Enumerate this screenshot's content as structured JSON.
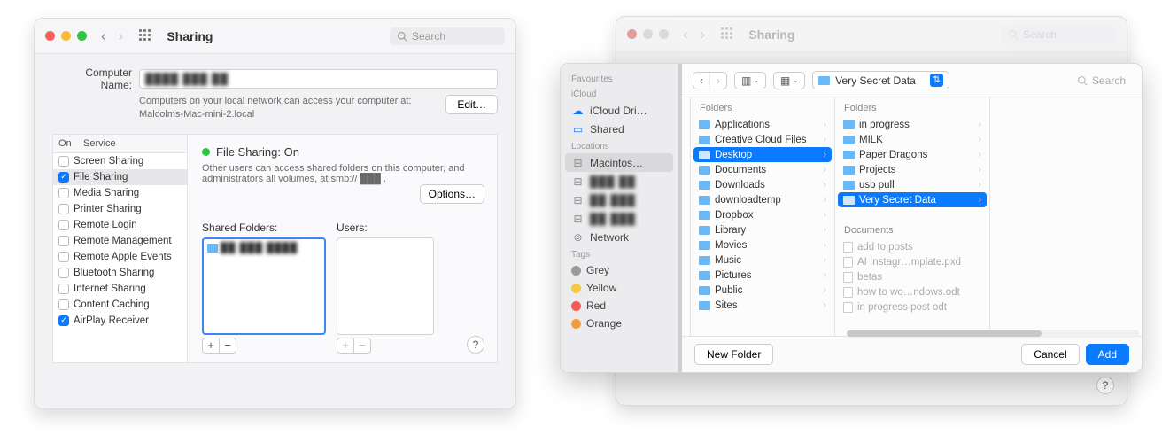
{
  "colors": {
    "accent": "#0a7bff",
    "green": "#2bc840"
  },
  "winA": {
    "title": "Sharing",
    "search_placeholder": "Search",
    "computer_name_label": "Computer Name:",
    "computer_name_value": "████  ███ ██",
    "hint_line1": "Computers on your local network can access your computer at:",
    "hint_line2": "Malcolms-Mac-mini-2.local",
    "edit_label": "Edit…",
    "svc_head_on": "On",
    "svc_head_service": "Service",
    "services": [
      {
        "on": false,
        "name": "Screen Sharing"
      },
      {
        "on": true,
        "name": "File Sharing",
        "selected": true
      },
      {
        "on": false,
        "name": "Media Sharing"
      },
      {
        "on": false,
        "name": "Printer Sharing"
      },
      {
        "on": false,
        "name": "Remote Login"
      },
      {
        "on": false,
        "name": "Remote Management"
      },
      {
        "on": false,
        "name": "Remote Apple Events"
      },
      {
        "on": false,
        "name": "Bluetooth Sharing"
      },
      {
        "on": false,
        "name": "Internet Sharing"
      },
      {
        "on": false,
        "name": "Content Caching"
      },
      {
        "on": true,
        "name": "AirPlay Receiver"
      }
    ],
    "status_title": "File Sharing: On",
    "status_desc": "Other users can access shared folders on this computer, and administrators all volumes, at smb://  ███ .",
    "options_label": "Options…",
    "shared_folders_label": "Shared Folders:",
    "users_label": "Users:",
    "shared_folder_item": "██ ███  ████",
    "help": "?"
  },
  "winB": {
    "title": "Sharing",
    "search_placeholder": "Search",
    "help": "?"
  },
  "sheet": {
    "sidebar": {
      "favourites": "Favourites",
      "icloud": "iCloud",
      "icloud_items": [
        "iCloud Dri…",
        "Shared"
      ],
      "locations": "Locations",
      "loc_items": [
        "Macintos…",
        "███ ██",
        "██ ███",
        "██ ███",
        "Network"
      ],
      "tags": "Tags",
      "tag_items": [
        {
          "name": "Grey",
          "color": "#9a9a9a"
        },
        {
          "name": "Yellow",
          "color": "#f7c844"
        },
        {
          "name": "Red",
          "color": "#f45b55"
        },
        {
          "name": "Orange",
          "color": "#f29b3f"
        }
      ]
    },
    "toolbar": {
      "path": "Very Secret Data",
      "search_placeholder": "Search"
    },
    "col1": {
      "head": "Folders",
      "items": [
        "Applications",
        "Creative Cloud Files",
        "Desktop",
        "Documents",
        "Downloads",
        "downloadtemp",
        "Dropbox",
        "Library",
        "Movies",
        "Music",
        "Pictures",
        "Public",
        "Sites"
      ],
      "selected_index": 2
    },
    "col2": {
      "head": "Folders",
      "items": [
        "in progress",
        "MILK",
        "Paper Dragons",
        "Projects",
        "usb pull",
        "Very Secret Data"
      ],
      "selected_index": 5,
      "docs_head": "Documents",
      "docs": [
        "add to posts",
        "AI Instagr…mplate.pxd",
        "betas",
        "how to wo…ndows.odt",
        "in progress post odt"
      ]
    },
    "footer": {
      "new_folder": "New Folder",
      "cancel": "Cancel",
      "add": "Add"
    }
  }
}
